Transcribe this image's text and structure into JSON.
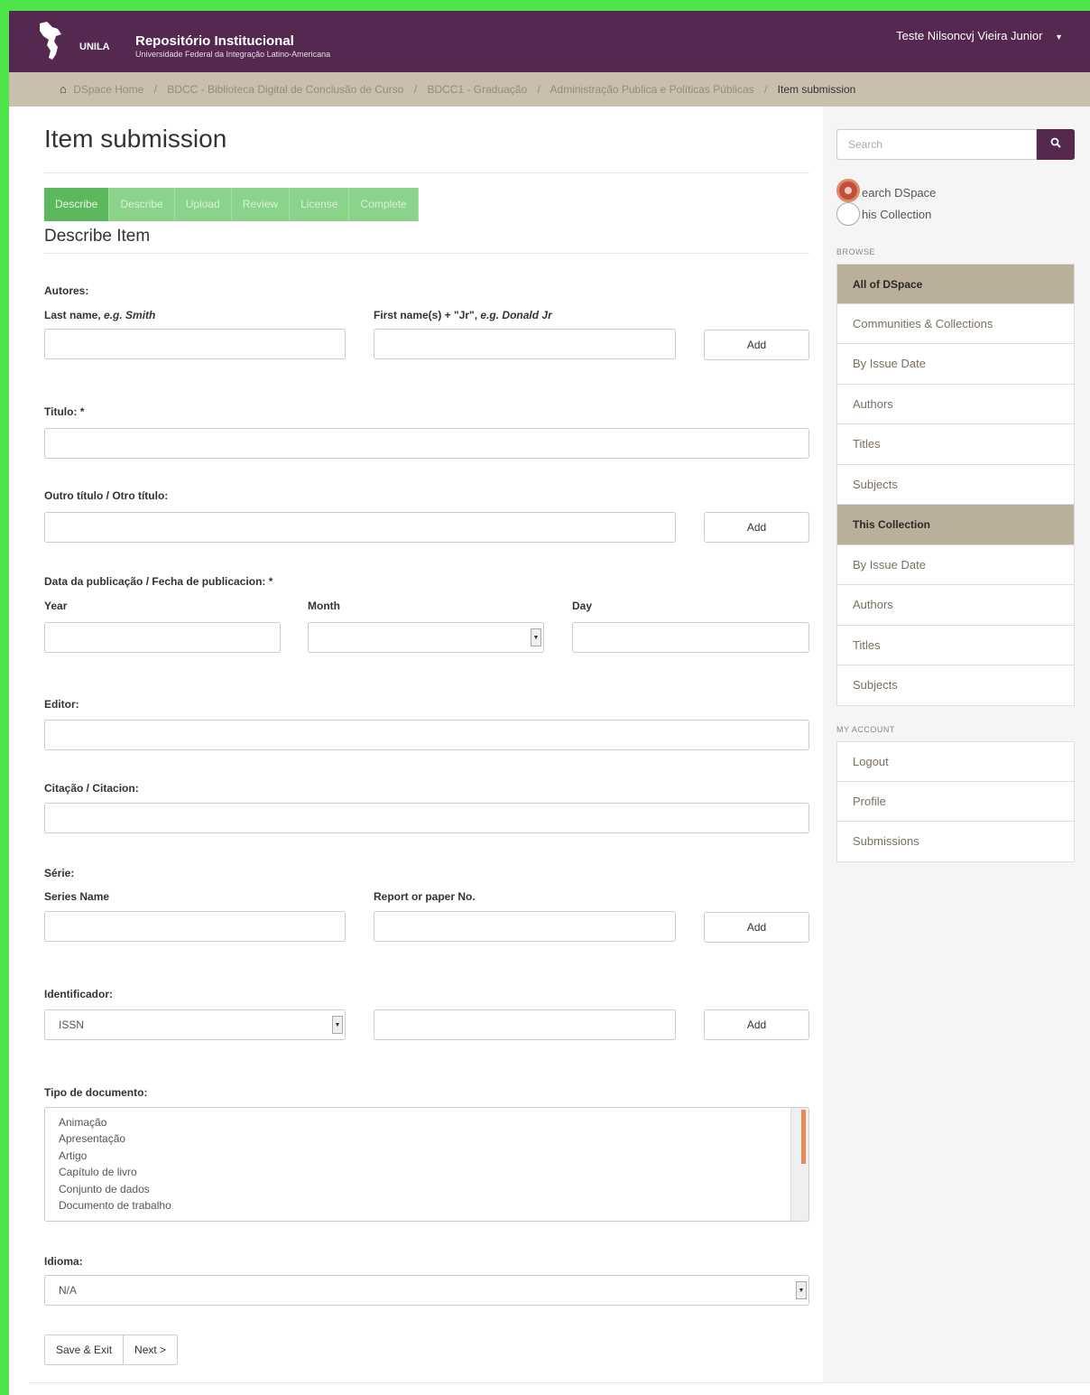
{
  "header": {
    "logo_text": "UNILA",
    "title": "Repositório Institucional",
    "subtitle": "Universidade Federal da Integração Latino-Americana",
    "user_name": "Teste Nilsoncvj Vieira Junior",
    "caret": "▼"
  },
  "breadcrumb": {
    "items": [
      "DSpace Home",
      "BDCC - Biblioteca Digital de Conclusão de Curso",
      "BDCC1 - Graduação",
      "Administração Publica e Políticas Públicas"
    ],
    "current": "Item submission",
    "separator": "/"
  },
  "page": {
    "title": "Item submission",
    "steps": [
      "Describe",
      "Describe",
      "Upload",
      "Review",
      "License",
      "Complete"
    ],
    "section_title": "Describe Item"
  },
  "form": {
    "autores_label": "Autores:",
    "last_name_label": "Last name, ",
    "last_name_eg": "e.g. Smith",
    "first_name_label": "First name(s) + \"Jr\", ",
    "first_name_eg": "e.g. Donald Jr",
    "add_label": "Add",
    "titulo_label": "Titulo: *",
    "outro_titulo_label": "Outro título / Otro título:",
    "data_label": "Data da publicação / Fecha de publicacion: *",
    "year_label": "Year",
    "month_label": "Month",
    "day_label": "Day",
    "editor_label": "Editor:",
    "citacao_label": "Citação / Citacion:",
    "serie_label": "Série:",
    "series_name_label": "Series Name",
    "report_label": "Report or paper No.",
    "identificador_label": "Identificador:",
    "identificador_value": "ISSN",
    "tipo_label": "Tipo de documento:",
    "tipo_options": [
      "Animação",
      "Apresentação",
      "Artigo",
      "Capítulo de livro",
      "Conjunto de dados",
      "Documento de trabalho"
    ],
    "idioma_label": "Idioma:",
    "idioma_value": "N/A",
    "save_exit_label": "Save & Exit",
    "next_label": "Next >"
  },
  "sidebar": {
    "search_placeholder": "Search",
    "radio_dspace": "earch DSpace",
    "radio_collection": "his Collection",
    "browse_heading": "BROWSE",
    "all_of_dspace": "All of DSpace",
    "dspace_items": [
      "Communities & Collections",
      "By Issue Date",
      "Authors",
      "Titles",
      "Subjects"
    ],
    "this_collection": "This Collection",
    "collection_items": [
      "By Issue Date",
      "Authors",
      "Titles",
      "Subjects"
    ],
    "account_heading": "MY ACCOUNT",
    "account_items": [
      "Logout",
      "Profile",
      "Submissions"
    ]
  },
  "colors": {
    "header_bg": "#54284f",
    "breadcrumb_bg": "#c8c0ac",
    "step_active": "#5cb85c",
    "step_inactive": "#8bd28b",
    "browse_header": "#b9af9a",
    "frame": "#4ee44a"
  }
}
